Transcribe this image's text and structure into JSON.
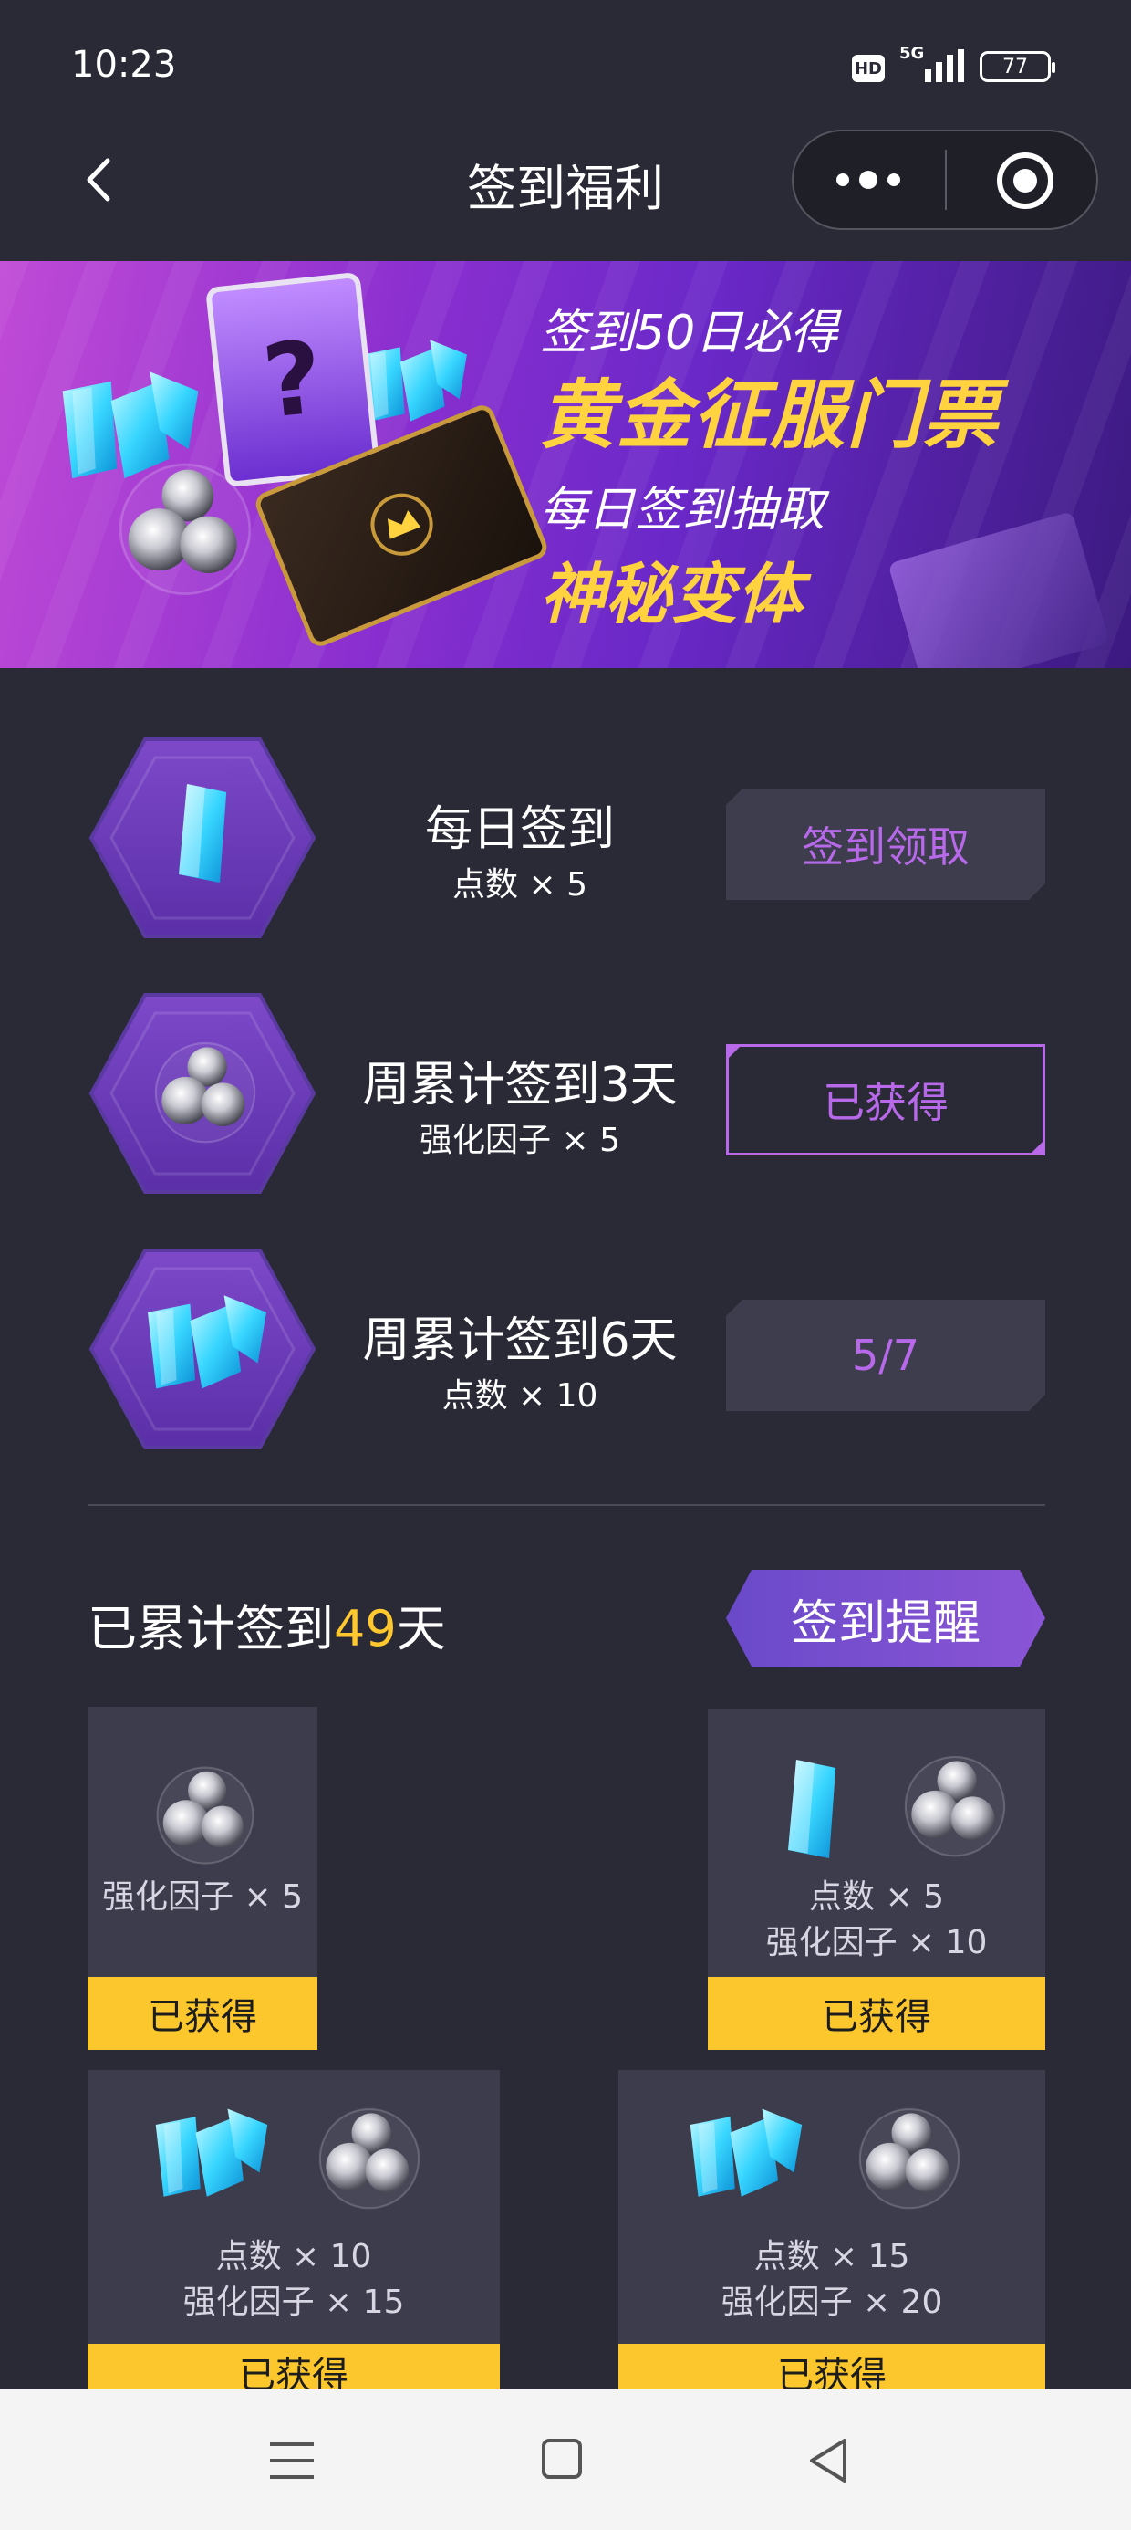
{
  "status_bar": {
    "time": "10:23",
    "hd": "HD",
    "network": "5G",
    "battery": "77"
  },
  "nav": {
    "title": "签到福利"
  },
  "banner": {
    "line1": "签到50日必得",
    "line2": "黄金征服门票",
    "line3": "每日签到抽取",
    "line4": "神秘变体"
  },
  "tasks": [
    {
      "title": "每日签到",
      "reward": "点数 × 5",
      "button": "签到领取",
      "icon": "crystal-icon"
    },
    {
      "title": "周累计签到3天",
      "reward": "强化因子 × 5",
      "button": "已获得",
      "icon": "orb-icon"
    },
    {
      "title": "周累计签到6天",
      "reward": "点数 × 10",
      "button": "5/7",
      "icon": "crystal-cluster-icon"
    }
  ],
  "cumulative": {
    "prefix": "已累计签到",
    "days": "49",
    "suffix": "天",
    "remind_button": "签到提醒"
  },
  "reward_cards": [
    {
      "lines": [
        "强化因子 × 5"
      ],
      "status": "已获得"
    },
    {
      "lines": [
        "点数 × 5",
        "强化因子 × 10"
      ],
      "status": "已获得"
    },
    {
      "lines": [
        "点数 × 10",
        "强化因子 × 15"
      ],
      "status": "已获得"
    },
    {
      "lines": [
        "点数 × 15",
        "强化因子 × 20"
      ],
      "status": "已获得"
    }
  ],
  "colors": {
    "accent_purple": "#b769ea",
    "gold": "#fcc72c",
    "background": "#2a2a36"
  }
}
